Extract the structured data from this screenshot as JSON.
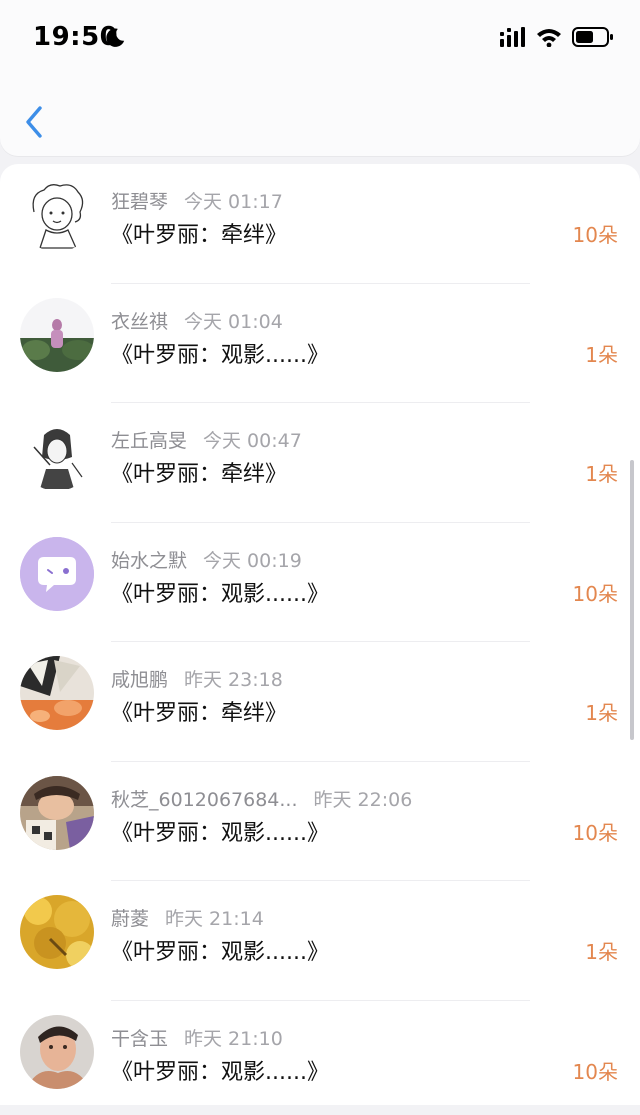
{
  "status_bar": {
    "time": "19:50",
    "icons": [
      "moon-icon",
      "signal-icon",
      "wifi-icon",
      "battery-icon"
    ]
  },
  "nav": {
    "back_icon": "chevron-left-icon",
    "accent_color": "#3d8ee8"
  },
  "colors": {
    "count": "#e3874f",
    "name": "#8e8e93",
    "title": "#111111"
  },
  "items": [
    {
      "name": "狂碧琴",
      "time": "今天 01:17",
      "gift": "《叶罗丽：牵绊》",
      "count": "10朵",
      "avatar": "cartoon-girl-sketch"
    },
    {
      "name": "衣丝祺",
      "time": "今天 01:04",
      "gift": "《叶罗丽：观影......》",
      "count": "1朵",
      "avatar": "girl-in-garden"
    },
    {
      "name": "左丘高旻",
      "time": "今天 00:47",
      "gift": "《叶罗丽：牵绊》",
      "count": "1朵",
      "avatar": "anime-sketch"
    },
    {
      "name": "始水之默",
      "time": "今天 00:19",
      "gift": "《叶罗丽：观影......》",
      "count": "10朵",
      "avatar": "purple-chat-bubble"
    },
    {
      "name": "咸旭鹏",
      "time": "昨天 23:18",
      "gift": "《叶罗丽：牵绊》",
      "count": "1朵",
      "avatar": "butterfly-photo"
    },
    {
      "name": "秋芝_6012067684...",
      "time": "昨天 22:06",
      "gift": "《叶罗丽：观影......》",
      "count": "10朵",
      "avatar": "girl-with-cards"
    },
    {
      "name": "蔚菱",
      "time": "昨天 21:14",
      "gift": "《叶罗丽：观影......》",
      "count": "1朵",
      "avatar": "golden-leaves"
    },
    {
      "name": "干含玉",
      "time": "昨天 21:10",
      "gift": "《叶罗丽：观影......》",
      "count": "10朵",
      "avatar": "man-portrait"
    }
  ]
}
